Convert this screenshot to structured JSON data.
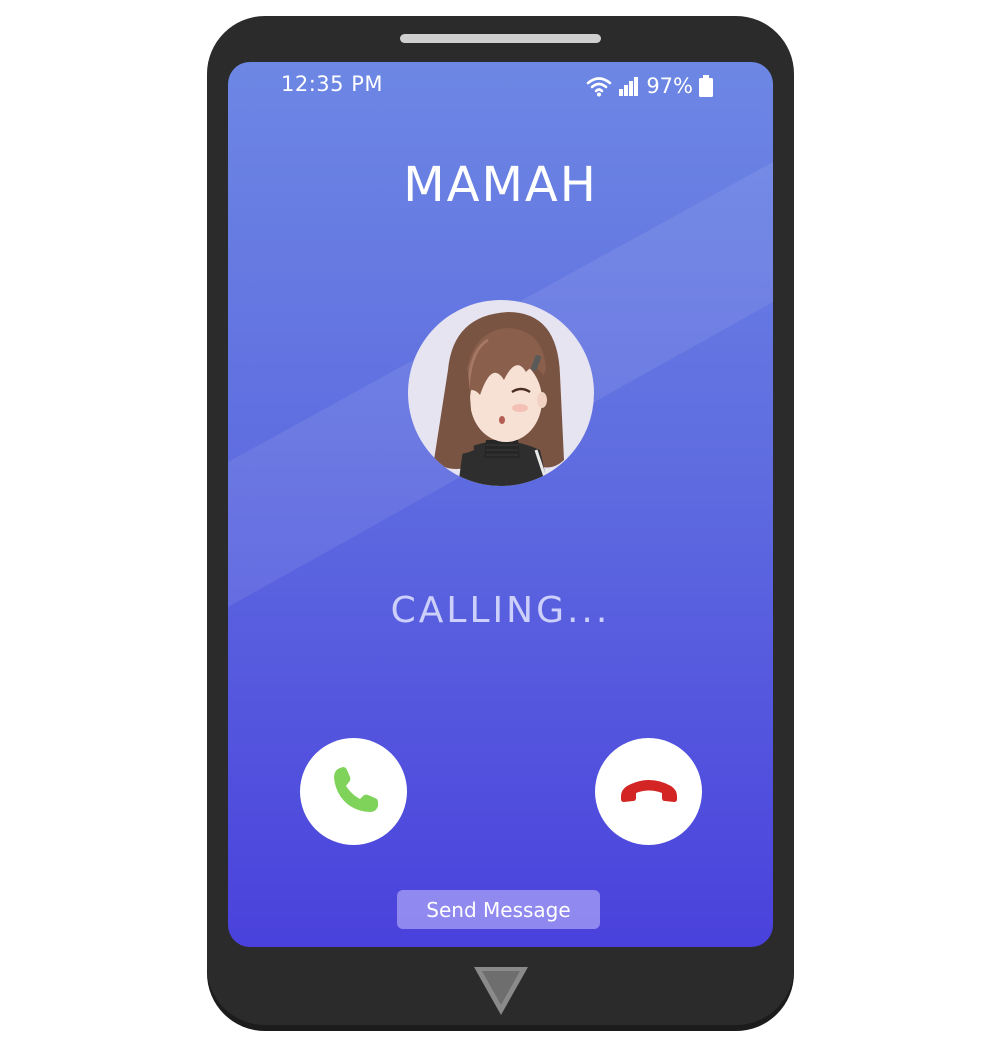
{
  "status_bar": {
    "time": "12:35 PM",
    "battery": "97%",
    "icons": [
      "wifi-icon",
      "signal-icon",
      "battery-icon"
    ]
  },
  "contact": {
    "name": "MAMAH",
    "avatar": "anime-girl-avatar"
  },
  "call": {
    "status": "CALLING..."
  },
  "actions": {
    "accept_icon": "phone-accept-icon",
    "decline_icon": "phone-decline-icon",
    "send_message_label": "Send Message"
  },
  "colors": {
    "screen_top": "#6d87e4",
    "screen_bottom": "#4a41dc",
    "accept": "#7fd25a",
    "decline": "#d42525",
    "device_body": "#2b2b2b"
  }
}
